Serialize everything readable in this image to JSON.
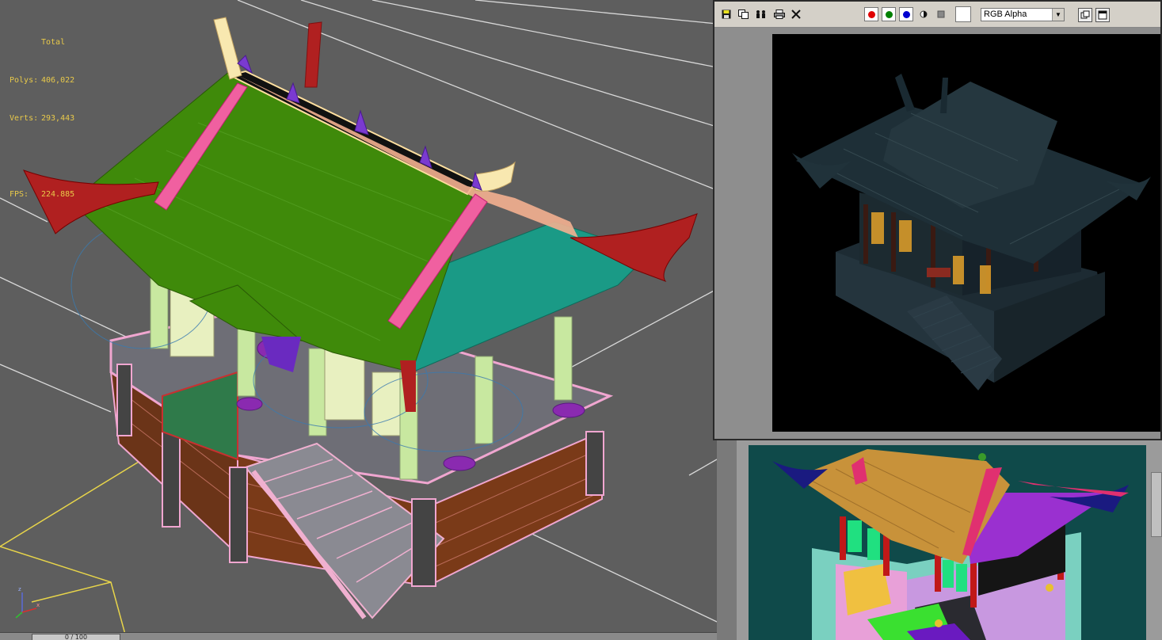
{
  "viewport": {
    "stats": {
      "total_label": "Total",
      "polys_label": "Polys:",
      "polys_value": "406,022",
      "verts_label": "Verts:",
      "verts_value": "293,443",
      "fps_label": "FPS:",
      "fps_value": "224.885"
    },
    "timeline_label": "0 / 100"
  },
  "frame_window": {
    "toolbar": {
      "icons": [
        "save-icon",
        "copy-icon",
        "clone-icon",
        "print-icon",
        "clear-icon"
      ],
      "channels": [
        {
          "name": "red-channel",
          "color": "#e00000"
        },
        {
          "name": "green-channel",
          "color": "#008000"
        },
        {
          "name": "blue-channel",
          "color": "#0000d0"
        }
      ],
      "channel_select": "RGB Alpha"
    }
  },
  "colors": {
    "viewport_bg": "#5e5e5e",
    "stats_text": "#e8c94a",
    "roof_main": "#3f8a0a",
    "roof_side": "#1a9a86",
    "wire_pink": "#e6a0c8"
  }
}
